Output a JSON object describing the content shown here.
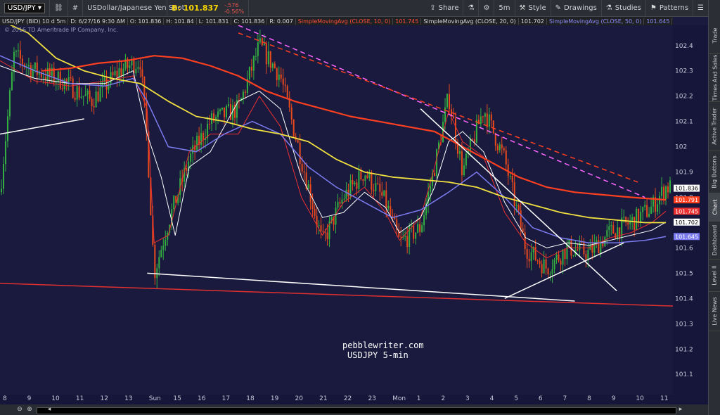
{
  "toolbar": {
    "symbol": "USD/JPY",
    "description": "USDollar/Japanese Yen Spot",
    "bid": "B: 101.837",
    "change_abs": "-.576",
    "change_pct": "-0.56%",
    "share": "Share",
    "timeframe": "5m",
    "style": "Style",
    "drawings": "Drawings",
    "studies": "Studies",
    "patterns": "Patterns"
  },
  "infobar": {
    "title": "USD/JPY (BID) 10 d 5m",
    "date": "D: 6/27/16 9:30 AM",
    "open": "O: 101.836",
    "high": "H: 101.84",
    "low": "L: 101.831",
    "close": "C: 101.836",
    "range": "R: 0.007",
    "sma10": "SimpleMovingAvg (CLOSE, 10, 0)",
    "sma10_val": "101.745",
    "sma20": "SimpleMovingAvg (CLOSE, 20, 0)",
    "sma20_val": "101.702",
    "sma50": "SimpleMovingAvg (CLOSE, 50, 0)",
    "sma50_val": "101.645"
  },
  "copyright": "© 2016 TD Ameritrade IP Company, Inc.",
  "watermark": {
    "line1": "pebblewriter.com",
    "line2": "USDJPY 5-min"
  },
  "sidebar": [
    "Trade",
    "Times And Sales",
    "Active Trader",
    "Big Buttons",
    "Chart",
    "Dashboard",
    "Level II",
    "Live News"
  ],
  "colors": {
    "background": "#1a1a3f",
    "up": "#33b040",
    "down": "#e84a1c",
    "sma10": "#e83030",
    "sma20": "#ffffff",
    "sma50": "#7b7bf0",
    "sma200": "#f0e040",
    "sma_long": "#ff4020",
    "trend_white": "#ffffff",
    "trend_magenta": "#ff66ff",
    "trend_orange": "#ff4020"
  },
  "chart_data": {
    "type": "candlestick",
    "title": "USD/JPY (BID) 10 d 5m",
    "ylim": [
      101.02,
      102.48
    ],
    "yticks": [
      "102.4",
      "102.3",
      "102.2",
      "102.1",
      "102",
      "101.9",
      "101.8",
      "101.7",
      "101.6",
      "101.5",
      "101.4",
      "101.3",
      "101.2",
      "101.1"
    ],
    "xticks": [
      "8",
      "9",
      "10",
      "11",
      "12",
      "13",
      "Sun",
      "15",
      "16",
      "17",
      "18",
      "19",
      "20",
      "21",
      "22",
      "23",
      "Mon",
      "1",
      "2",
      "3",
      "4",
      "5",
      "6",
      "7",
      "8",
      "9",
      "10",
      "11"
    ],
    "price_labels": [
      {
        "text": "101.836",
        "color": "#ffffff",
        "bg": "#ffffff",
        "fg": "#000000",
        "value": 101.836
      },
      {
        "text": "101.791",
        "bg": "#ff4020",
        "fg": "#ffffff",
        "value": 101.79
      },
      {
        "text": "101.745",
        "bg": "#e83030",
        "fg": "#ffffff",
        "value": 101.745
      },
      {
        "text": "101.702",
        "bg": "#ffffff",
        "fg": "#000000",
        "value": 101.702
      },
      {
        "text": "101.645",
        "bg": "#7b7bf0",
        "fg": "#ffffff",
        "value": 101.645
      }
    ],
    "price_path": [
      [
        0,
        101.82
      ],
      [
        2,
        102.36
      ],
      [
        5,
        102.3
      ],
      [
        9,
        102.26
      ],
      [
        13,
        102.18
      ],
      [
        17,
        102.3
      ],
      [
        20,
        102.34
      ],
      [
        21,
        102.02
      ],
      [
        22,
        101.5
      ],
      [
        24,
        101.7
      ],
      [
        27,
        101.95
      ],
      [
        30,
        102.1
      ],
      [
        34,
        102.15
      ],
      [
        37,
        102.4
      ],
      [
        40,
        102.28
      ],
      [
        43,
        101.95
      ],
      [
        46,
        101.62
      ],
      [
        49,
        101.8
      ],
      [
        52,
        101.9
      ],
      [
        55,
        101.78
      ],
      [
        57,
        101.62
      ],
      [
        60,
        101.68
      ],
      [
        62,
        101.92
      ],
      [
        64,
        102.2
      ],
      [
        66,
        101.9
      ],
      [
        69,
        102.15
      ],
      [
        72,
        101.95
      ],
      [
        75,
        101.6
      ],
      [
        78,
        101.52
      ],
      [
        81,
        101.6
      ],
      [
        84,
        101.58
      ],
      [
        87,
        101.66
      ],
      [
        90,
        101.7
      ],
      [
        93,
        101.76
      ],
      [
        95,
        101.84
      ]
    ],
    "series": [
      {
        "name": "SimpleMovingAvg (CLOSE, 10, 0)",
        "values": [
          [
            0,
            102.34
          ],
          [
            5,
            102.26
          ],
          [
            10,
            102.24
          ],
          [
            15,
            102.26
          ],
          [
            19,
            102.28
          ],
          [
            21,
            102.15
          ],
          [
            22,
            101.62
          ],
          [
            24,
            101.65
          ],
          [
            27,
            101.98
          ],
          [
            30,
            102.05
          ],
          [
            34,
            102.05
          ],
          [
            37,
            102.2
          ],
          [
            40,
            102.08
          ],
          [
            43,
            101.8
          ],
          [
            46,
            101.65
          ],
          [
            49,
            101.78
          ],
          [
            52,
            101.84
          ],
          [
            55,
            101.74
          ],
          [
            57,
            101.63
          ],
          [
            60,
            101.72
          ],
          [
            62,
            101.92
          ],
          [
            64,
            102.14
          ],
          [
            66,
            102.02
          ],
          [
            69,
            101.96
          ],
          [
            72,
            101.74
          ],
          [
            75,
            101.62
          ],
          [
            78,
            101.56
          ],
          [
            81,
            101.6
          ],
          [
            84,
            101.6
          ],
          [
            87,
            101.64
          ],
          [
            90,
            101.66
          ],
          [
            93,
            101.7
          ],
          [
            95,
            101.745
          ]
        ]
      },
      {
        "name": "SimpleMovingAvg (CLOSE, 20, 0)",
        "values": [
          [
            0,
            102.32
          ],
          [
            5,
            102.27
          ],
          [
            10,
            102.25
          ],
          [
            15,
            102.25
          ],
          [
            19,
            102.3
          ],
          [
            21,
            102.05
          ],
          [
            23,
            101.88
          ],
          [
            25,
            101.65
          ],
          [
            27,
            101.92
          ],
          [
            30,
            101.98
          ],
          [
            34,
            102.18
          ],
          [
            37,
            102.22
          ],
          [
            40,
            102.15
          ],
          [
            43,
            101.88
          ],
          [
            46,
            101.72
          ],
          [
            49,
            101.74
          ],
          [
            52,
            101.82
          ],
          [
            55,
            101.76
          ],
          [
            57,
            101.66
          ],
          [
            60,
            101.72
          ],
          [
            62,
            101.84
          ],
          [
            64,
            102.02
          ],
          [
            66,
            102.06
          ],
          [
            69,
            101.98
          ],
          [
            72,
            101.78
          ],
          [
            75,
            101.64
          ],
          [
            78,
            101.6
          ],
          [
            81,
            101.62
          ],
          [
            84,
            101.61
          ],
          [
            87,
            101.63
          ],
          [
            90,
            101.65
          ],
          [
            93,
            101.67
          ],
          [
            95,
            101.702
          ]
        ]
      },
      {
        "name": "SimpleMovingAvg (CLOSE, 50, 0)",
        "values": [
          [
            0,
            102.36
          ],
          [
            5,
            102.3
          ],
          [
            10,
            102.25
          ],
          [
            15,
            102.24
          ],
          [
            19,
            102.27
          ],
          [
            21,
            102.18
          ],
          [
            24,
            102.0
          ],
          [
            28,
            101.98
          ],
          [
            32,
            102.05
          ],
          [
            36,
            102.1
          ],
          [
            40,
            102.05
          ],
          [
            44,
            101.92
          ],
          [
            48,
            101.84
          ],
          [
            52,
            101.78
          ],
          [
            56,
            101.72
          ],
          [
            60,
            101.75
          ],
          [
            64,
            101.82
          ],
          [
            68,
            101.9
          ],
          [
            72,
            101.8
          ],
          [
            76,
            101.68
          ],
          [
            80,
            101.64
          ],
          [
            84,
            101.62
          ],
          [
            88,
            101.62
          ],
          [
            92,
            101.63
          ],
          [
            95,
            101.645
          ]
        ]
      },
      {
        "name": "SMA long (yellow)",
        "values": [
          [
            0,
            102.5
          ],
          [
            4,
            102.45
          ],
          [
            8,
            102.35
          ],
          [
            12,
            102.3
          ],
          [
            16,
            102.27
          ],
          [
            20,
            102.25
          ],
          [
            24,
            102.18
          ],
          [
            28,
            102.12
          ],
          [
            32,
            102.1
          ],
          [
            36,
            102.07
          ],
          [
            40,
            102.05
          ],
          [
            44,
            102.02
          ],
          [
            48,
            101.95
          ],
          [
            52,
            101.9
          ],
          [
            56,
            101.88
          ],
          [
            60,
            101.87
          ],
          [
            64,
            101.86
          ],
          [
            68,
            101.84
          ],
          [
            72,
            101.8
          ],
          [
            76,
            101.77
          ],
          [
            80,
            101.74
          ],
          [
            84,
            101.72
          ],
          [
            88,
            101.71
          ],
          [
            92,
            101.7
          ],
          [
            95,
            101.7
          ]
        ]
      },
      {
        "name": "SMA long (orange)",
        "values": [
          [
            6,
            102.3
          ],
          [
            10,
            102.31
          ],
          [
            14,
            102.33
          ],
          [
            18,
            102.34
          ],
          [
            22,
            102.36
          ],
          [
            26,
            102.35
          ],
          [
            30,
            102.32
          ],
          [
            34,
            102.28
          ],
          [
            38,
            102.22
          ],
          [
            42,
            102.18
          ],
          [
            46,
            102.15
          ],
          [
            50,
            102.12
          ],
          [
            54,
            102.1
          ],
          [
            58,
            102.08
          ],
          [
            62,
            102.06
          ],
          [
            66,
            102.0
          ],
          [
            70,
            101.94
          ],
          [
            74,
            101.88
          ],
          [
            78,
            101.84
          ],
          [
            82,
            101.82
          ],
          [
            86,
            101.81
          ],
          [
            90,
            101.8
          ],
          [
            95,
            101.79
          ]
        ]
      }
    ],
    "trendlines": [
      {
        "color": "#ffffff",
        "dash": false,
        "from": [
          0,
          102.05
        ],
        "to": [
          12,
          102.11
        ]
      },
      {
        "color": "#ffffff",
        "dash": false,
        "from": [
          21,
          101.5
        ],
        "to": [
          82,
          101.39
        ]
      },
      {
        "color": "#ffffff",
        "dash": false,
        "from": [
          60,
          102.15
        ],
        "to": [
          88,
          101.43
        ]
      },
      {
        "color": "#ffffff",
        "dash": false,
        "from": [
          72,
          101.4
        ],
        "to": [
          89,
          101.62
        ]
      },
      {
        "color": "#ff66ff",
        "dash": true,
        "from": [
          34,
          102.48
        ],
        "to": [
          92,
          101.8
        ]
      },
      {
        "color": "#ff4020",
        "dash": true,
        "from": [
          34,
          102.45
        ],
        "to": [
          91,
          101.86
        ]
      },
      {
        "color": "#e03030",
        "dash": false,
        "from": [
          0,
          101.46
        ],
        "to": [
          96,
          101.37
        ]
      }
    ]
  }
}
